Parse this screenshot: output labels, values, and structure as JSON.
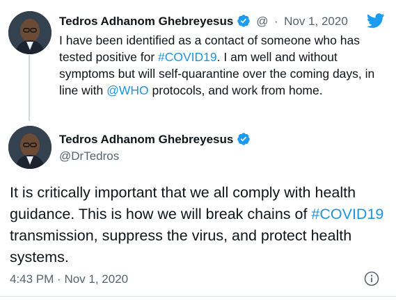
{
  "reply_tweet": {
    "author_name": "Tedros Adhanom Ghebreyesus",
    "handle_partial": "@",
    "separator": "·",
    "date": "Nov 1, 2020",
    "text_before_hashtag": "I have been identified as a contact of someone who has tested positive for ",
    "hashtag": "#COVID19",
    "text_after_hashtag": ". I am well and without symptoms but will self-quarantine over the coming days, in line with ",
    "mention": "@WHO",
    "text_end": " protocols, and work from home."
  },
  "main_tweet": {
    "author_name": "Tedros Adhanom Ghebreyesus",
    "handle": "@DrTedros",
    "text_before_hashtag": "It is critically important that we all comply with health guidance. This is how we will break chains of ",
    "hashtag": "#COVID19",
    "text_after_hashtag": " transmission, suppress the virus, and protect health systems.",
    "time": "4:43 PM",
    "separator": "·",
    "date": "Nov 1, 2020"
  },
  "icons": {
    "brand": "twitter-bird-icon",
    "verified": "verified-badge-icon",
    "info": "info-icon"
  },
  "colors": {
    "link": "#1b95e0",
    "verified": "#1d9bf0",
    "twitter": "#1d9bf0",
    "secondary_text": "#536471"
  }
}
